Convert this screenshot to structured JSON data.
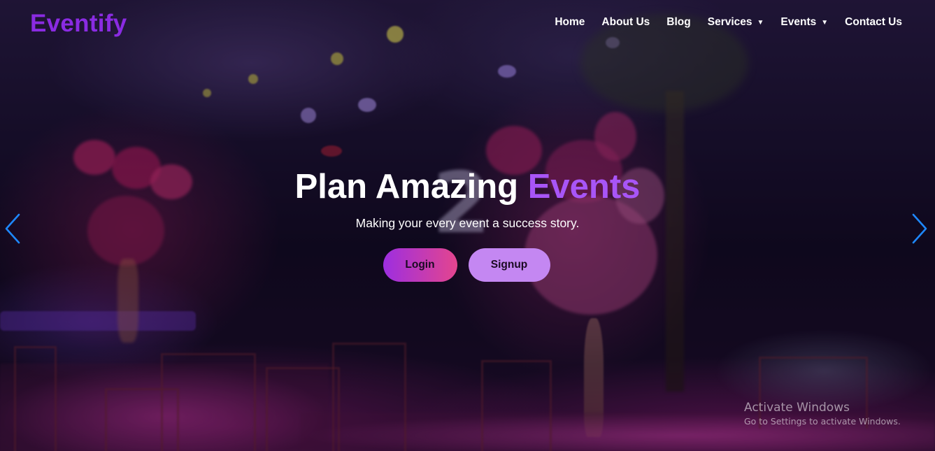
{
  "brand": {
    "name": "Eventify",
    "color": "#8a2be2"
  },
  "nav": {
    "items": [
      {
        "label": "Home",
        "dropdown": false
      },
      {
        "label": "About Us",
        "dropdown": false
      },
      {
        "label": "Blog",
        "dropdown": false
      },
      {
        "label": "Services",
        "dropdown": true
      },
      {
        "label": "Events",
        "dropdown": true
      },
      {
        "label": "Contact Us",
        "dropdown": false
      }
    ],
    "caret_icon": "caret-down-icon"
  },
  "hero": {
    "title_main": "Plan Amazing",
    "title_accent": "Events",
    "subtitle": "Making your every event a success story.",
    "login_label": "Login",
    "signup_label": "Signup",
    "accent_color": "#a855f7"
  },
  "carousel": {
    "prev_icon": "chevron-left-icon",
    "next_icon": "chevron-right-icon",
    "arrow_color": "#1e88ff"
  },
  "watermark": {
    "title": "Activate Windows",
    "subtitle": "Go to Settings to activate Windows."
  },
  "colors": {
    "login_gradient_start": "#9d2ee0",
    "login_gradient_end": "#e4458e",
    "signup_bg": "#c487f2"
  }
}
